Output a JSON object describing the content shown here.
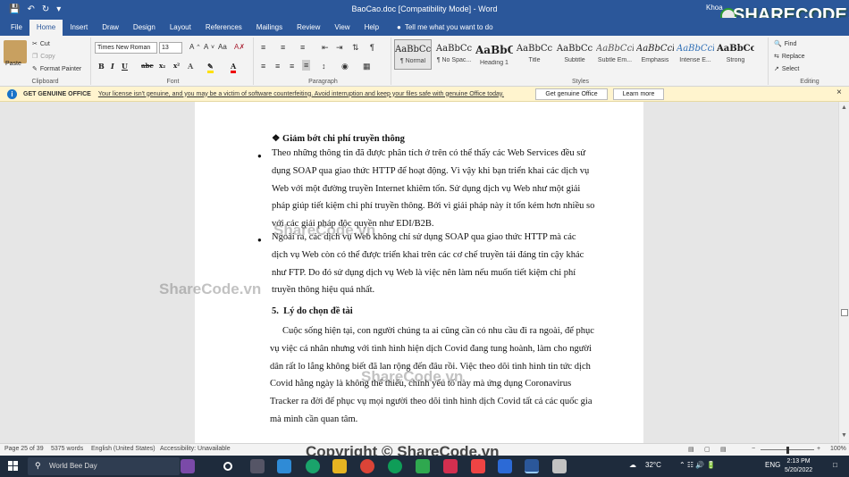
{
  "titlebar": {
    "title": "BaoCao.doc [Compatibility Mode] - Word",
    "user": "Khoa"
  },
  "tabs": [
    "File",
    "Home",
    "Insert",
    "Draw",
    "Design",
    "Layout",
    "References",
    "Mailings",
    "Review",
    "View",
    "Help"
  ],
  "tell_me": "Tell me what you want to do",
  "ribbon": {
    "clipboard": {
      "paste": "Paste",
      "cut": "Cut",
      "copy": "Copy",
      "format_painter": "Format Painter",
      "label": "Clipboard"
    },
    "font": {
      "name": "Times New Roman",
      "size": "13",
      "label": "Font"
    },
    "paragraph": {
      "label": "Paragraph"
    },
    "styles": {
      "label": "Styles",
      "items": [
        {
          "preview": "AaBbCc",
          "name": "¶ Normal"
        },
        {
          "preview": "AaBbCc",
          "name": "¶ No Spac..."
        },
        {
          "preview": "AaBbC",
          "name": "Heading 1"
        },
        {
          "preview": "AaBbCc",
          "name": "Title"
        },
        {
          "preview": "AaBbCc",
          "name": "Subtitle"
        },
        {
          "preview": "AaBbCcl",
          "name": "Subtle Em..."
        },
        {
          "preview": "AaBbCcl",
          "name": "Emphasis"
        },
        {
          "preview": "AaBbCcl",
          "name": "Intense E..."
        },
        {
          "preview": "AaBbCc",
          "name": "Strong"
        }
      ]
    },
    "editing": {
      "find": "Find",
      "replace": "Replace",
      "select": "Select",
      "label": "Editing"
    }
  },
  "warning": {
    "title": "GET GENUINE OFFICE",
    "message": "Your license isn't genuine, and you may be a victim of software counterfeiting. Avoid interruption and keep your files safe with genuine Office today.",
    "btn_genuine": "Get genuine Office",
    "btn_learn": "Learn more"
  },
  "document": {
    "subheading": "Giảm bớt chi phí truyền thông",
    "bullet1_lines": [
      "Theo những thông tin đã được phân tích ở trên có thể thấy các Web Services đều sử",
      "dụng SOAP qua giao thức HTTP để hoạt động. Vì vậy khi bạn triển khai các dịch vụ",
      "Web với một đường truyền Internet khiêm tốn. Sử dụng dịch vụ Web như một giải",
      "pháp giúp tiết kiệm chi phí truyền thông. Bởi vì giải pháp này ít tốn kém hơn nhiều so",
      "với các giải pháp độc quyền như EDI/B2B."
    ],
    "bullet2_lines": [
      "Ngoài ra, các dịch vụ Web không chỉ sử dụng SOAP qua giao thức HTTP mà các",
      "dịch vụ Web còn có thể được triển khai trên các cơ chế truyền tải đáng tin cậy khác",
      "như FTP. Do đó sử dụng dịch vụ Web là việc nên làm nếu muốn tiết kiệm chi phí",
      "truyền thông hiệu quả nhất."
    ],
    "section_number": "5.",
    "section_title": "Lý do chọn đề tài",
    "para_lines": [
      "Cuộc sống hiện tại, con người chúng ta ai cũng cần có nhu cầu đi ra ngoài, để phục",
      "vụ việc cá nhân nhưng với tình hình hiện dịch Covid đang tung hoành, làm cho người",
      "dân rất lo lắng không biết đã lan rộng đến đâu rồi. Việc theo dõi tình hình tin tức dịch",
      "Covid hằng ngày là không thể thiếu, chính yếu tố này mà ứng dụng Coronavirus",
      "Tracker ra đời để phục vụ mọi người theo dõi tình hình dịch Covid tất cả các quốc gia",
      "mà mình cần quan tâm."
    ]
  },
  "statusbar": {
    "page": "Page 25 of 39",
    "words": "5375 words",
    "language": "English (United States)",
    "accessibility": "Accessibility: Unavailable",
    "zoom": "100%"
  },
  "watermarks": {
    "brand": "SHARECODE.vn",
    "wm": "ShareCode.vn",
    "copyright": "Copyright © ShareCode.vn"
  },
  "taskbar": {
    "search": "World Bee Day",
    "weather": "32°C",
    "lang": "ENG",
    "time": "2:13 PM",
    "date": "5/20/2022"
  }
}
